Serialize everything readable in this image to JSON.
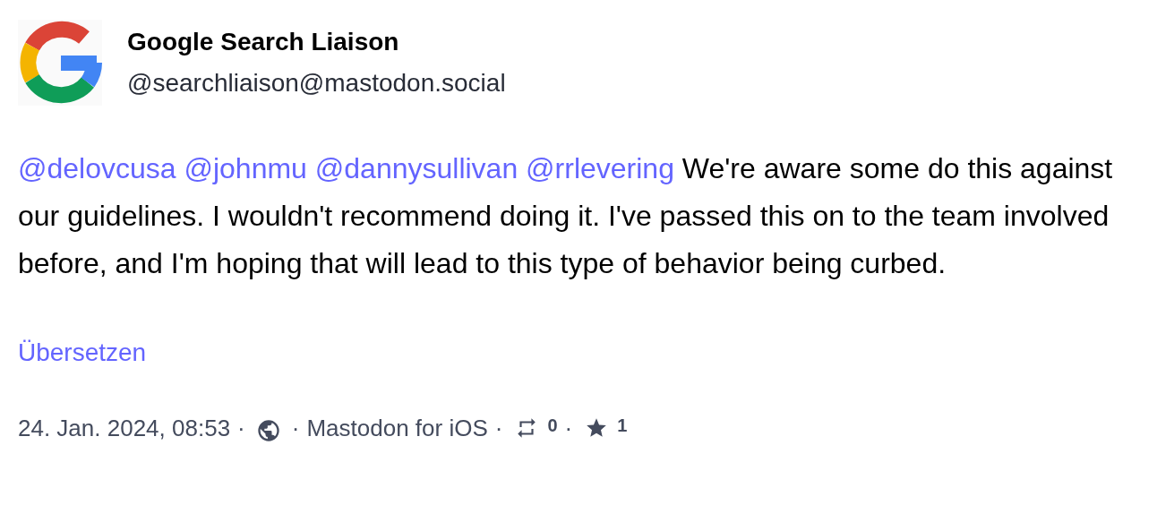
{
  "author": {
    "name": "Google Search Liaison",
    "handle": "@searchliaison@mastodon.social"
  },
  "content": [
    {
      "kind": "mention",
      "text": "@delovcusa"
    },
    {
      "kind": "mention",
      "text": "@johnmu"
    },
    {
      "kind": "mention",
      "text": "@dannysullivan"
    },
    {
      "kind": "mention",
      "text": "@rrlevering"
    },
    {
      "kind": "text",
      "text": "We're aware some do this against our guidelines. I wouldn't recommend doing it. I've passed this on to the team involved before, and I'm hoping that will lead to this type of behavior being curbed."
    }
  ],
  "translate_link": "Übersetzen",
  "footer": [
    {
      "kind": "text",
      "text": "24. Jan. 2024, 08:53"
    },
    {
      "kind": "sep",
      "text": "·"
    },
    {
      "kind": "globe"
    },
    {
      "kind": "sep",
      "text": "·"
    },
    {
      "kind": "link",
      "text": "Mastodon for iOS"
    },
    {
      "kind": "sep",
      "text": "·"
    },
    {
      "kind": "boost"
    },
    {
      "kind": "count",
      "text": "0"
    },
    {
      "kind": "sep",
      "text": "·"
    },
    {
      "kind": "star"
    },
    {
      "kind": "count",
      "text": "1"
    }
  ]
}
